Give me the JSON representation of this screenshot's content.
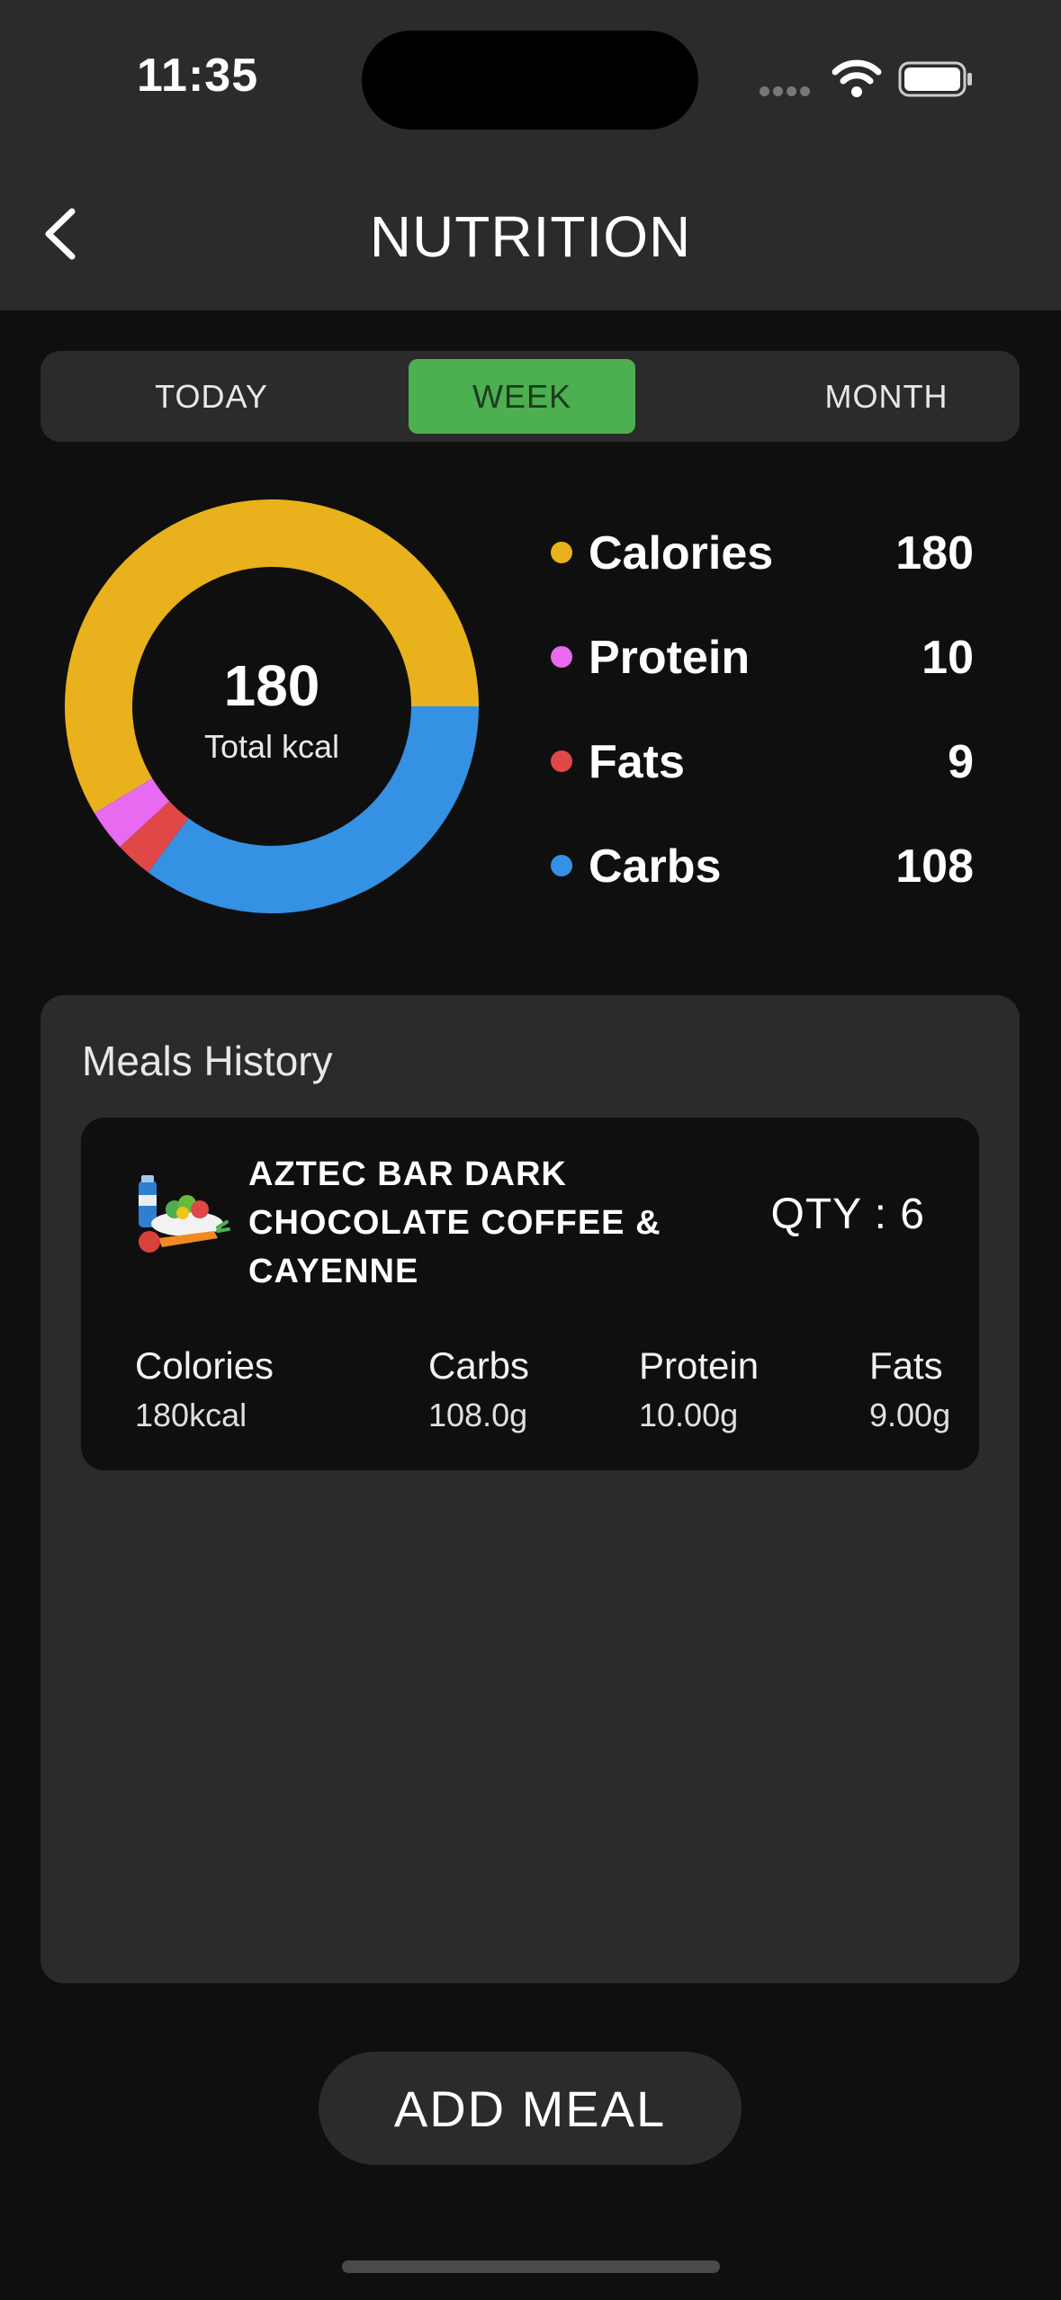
{
  "status_bar": {
    "time": "11:35"
  },
  "header": {
    "title": "NUTRITION"
  },
  "tabs": [
    {
      "label": "TODAY",
      "selected": false
    },
    {
      "label": "WEEK",
      "selected": true
    },
    {
      "label": "MONTH",
      "selected": false
    }
  ],
  "summary": {
    "total_value": "180",
    "total_label": "Total kcal"
  },
  "legend": [
    {
      "label": "Calories",
      "value": "180",
      "color": "#e9b11c"
    },
    {
      "label": "Protein",
      "value": "10",
      "color": "#e86af0"
    },
    {
      "label": "Fats",
      "value": "9",
      "color": "#e04848"
    },
    {
      "label": "Carbs",
      "value": "108",
      "color": "#3591e3"
    }
  ],
  "chart_data": {
    "type": "pie",
    "categories": [
      "Calories",
      "Protein",
      "Fats",
      "Carbs"
    ],
    "values": [
      180,
      10,
      9,
      108
    ],
    "colors": [
      "#e9b11c",
      "#e86af0",
      "#e04848",
      "#3591e3"
    ],
    "donut": true,
    "center_text": "180",
    "center_subtext": "Total kcal"
  },
  "meals": {
    "title": "Meals History",
    "items": [
      {
        "icon": "meal-food-icon",
        "name": "AZTEC BAR DARK CHOCOLATE COFFEE & CAYENNE",
        "qty": "QTY : 6",
        "stats": {
          "calories_label": "Colories",
          "calories_value": "180kcal",
          "carbs_label": "Carbs",
          "carbs_value": "108.0g",
          "protein_label": "Protein",
          "protein_value": "10.00g",
          "fats_label": "Fats",
          "fats_value": "9.00g"
        }
      }
    ]
  },
  "actions": {
    "add_meal_label": "ADD MEAL"
  }
}
